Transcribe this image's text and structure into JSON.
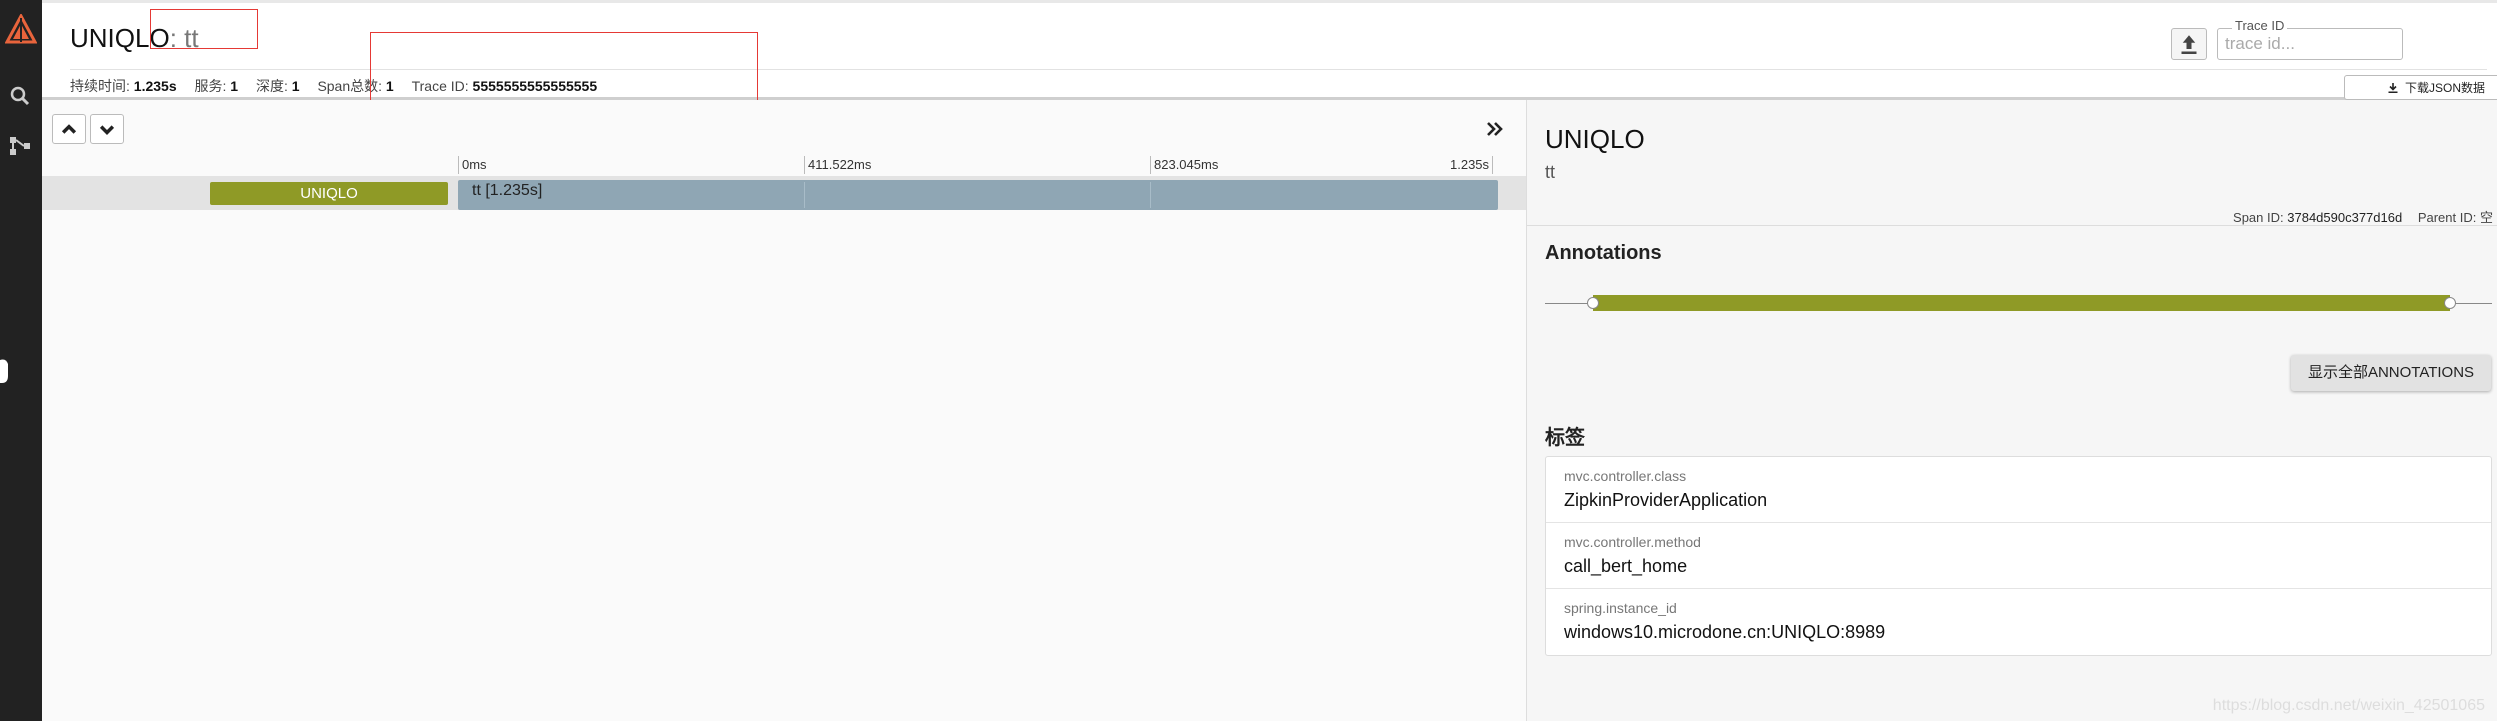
{
  "header": {
    "service_name": "UNIQLO",
    "separator": ":",
    "span_name": "tt",
    "meta": {
      "duration_label": "持续时间:",
      "duration_value": "1.235s",
      "services_label": "服务:",
      "services_value": "1",
      "depth_label": "深度:",
      "depth_value": "1",
      "span_total_label": "Span总数:",
      "span_total_value": "1",
      "trace_id_label": "Trace ID:",
      "trace_id_value": "5555555555555555"
    },
    "trace_search": {
      "label": "Trace ID",
      "placeholder": "trace id..."
    },
    "download_json_label": "下载JSON数据"
  },
  "timeline": {
    "ticks": [
      "0ms",
      "411.522ms",
      "823.045ms",
      "1.235s"
    ],
    "rows": [
      {
        "service": "UNIQLO",
        "span_label": "tt [1.235s]",
        "start_fraction": 0,
        "duration_fraction": 1
      }
    ]
  },
  "detail": {
    "service_name": "UNIQLO",
    "span_name": "tt",
    "span_id_label": "Span ID:",
    "span_id_value": "3784d590c377d16d",
    "parent_id_label": "Parent ID:",
    "parent_id_value": "空",
    "annotations_heading": "Annotations",
    "show_all_label": "显示全部ANNOTATIONS",
    "tags_heading": "标签",
    "tags": [
      {
        "key": "mvc.controller.class",
        "value": "ZipkinProviderApplication"
      },
      {
        "key": "mvc.controller.method",
        "value": "call_bert_home"
      },
      {
        "key": "spring.instance_id",
        "value": "windows10.microdone.cn:UNIQLO:8989"
      }
    ]
  },
  "watermark": "https://blog.csdn.net/weixin_42501065",
  "colors": {
    "sidebar": "#222222",
    "accent_logo": "#e8643c",
    "service_chip": "#8f9a26",
    "span_bar": "#8fa6b4",
    "highlight_box": "#e53935"
  },
  "icons": {
    "logo": "zipkin-logo-icon",
    "search": "search-icon",
    "dependencies": "dependency-graph-icon",
    "upload": "upload-icon",
    "download": "download-icon",
    "collapse_up": "chevron-up-icon",
    "expand_down": "chevron-down-icon",
    "toggle_detail": "double-chevron-right-icon"
  }
}
